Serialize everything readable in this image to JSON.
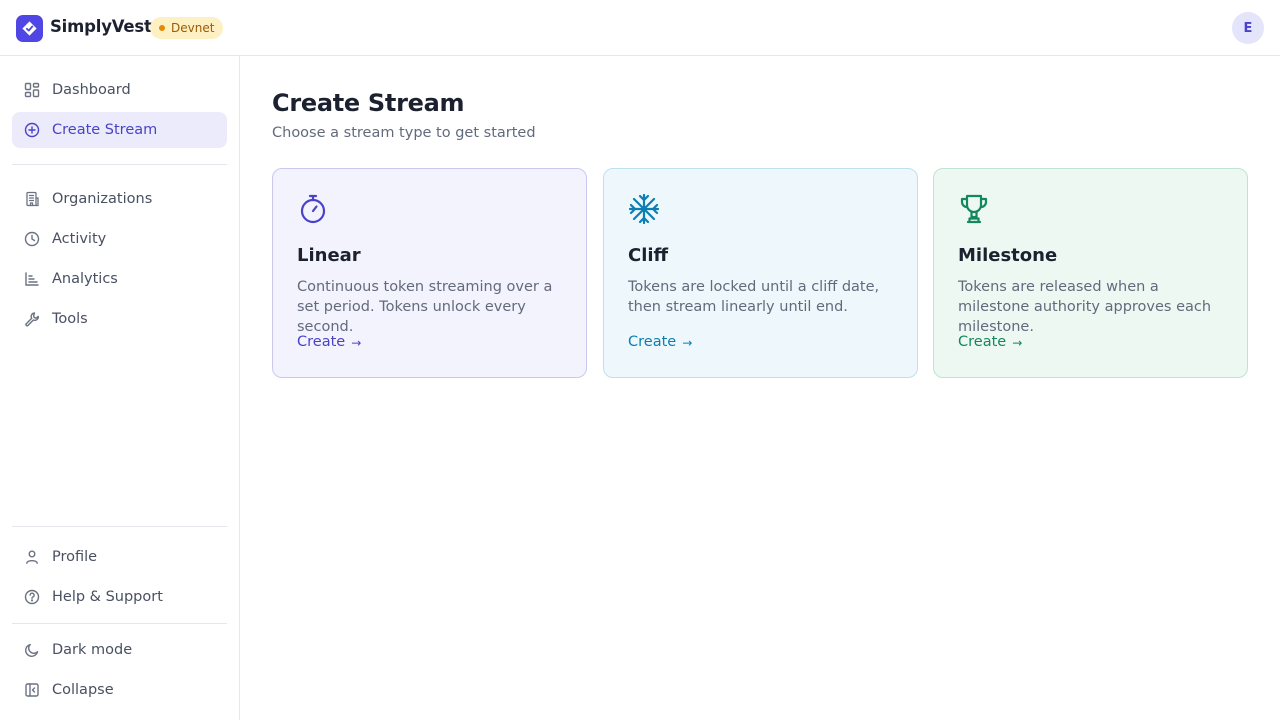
{
  "header": {
    "brand": "SimplyVest",
    "env_badge": "Devnet",
    "avatar_initial": "E"
  },
  "sidebar": {
    "top_items": [
      {
        "label": "Dashboard",
        "icon": "dashboard-icon"
      },
      {
        "label": "Create Stream",
        "icon": "plus-circle-icon",
        "active": true
      }
    ],
    "main_items": [
      {
        "label": "Organizations",
        "icon": "building-icon"
      },
      {
        "label": "Activity",
        "icon": "clock-icon"
      },
      {
        "label": "Analytics",
        "icon": "bar-chart-icon"
      },
      {
        "label": "Tools",
        "icon": "wrench-icon"
      }
    ],
    "bottom_items": [
      {
        "label": "Profile",
        "icon": "user-icon"
      },
      {
        "label": "Help & Support",
        "icon": "help-circle-icon"
      }
    ],
    "footer_items": [
      {
        "label": "Dark mode",
        "icon": "moon-icon"
      },
      {
        "label": "Collapse",
        "icon": "collapse-icon"
      }
    ]
  },
  "page": {
    "title": "Create Stream",
    "subtitle": "Choose a stream type to get started"
  },
  "cards": [
    {
      "title": "Linear",
      "description": "Continuous token streaming over a set period. Tokens unlock every second.",
      "link": "Create",
      "arrow": "→",
      "icon": "stopwatch-icon",
      "accent": "#4a43c9",
      "background": "#f3f3fd",
      "border": "#c9c8ef"
    },
    {
      "title": "Cliff",
      "description": "Tokens are locked until a cliff date, then stream linearly until end.",
      "link": "Create",
      "arrow": "→",
      "icon": "snowflake-icon",
      "accent": "#0b7fb3",
      "background": "#eef7fb",
      "border": "#bfe0ee"
    },
    {
      "title": "Milestone",
      "description": "Tokens are released when a milestone authority approves each milestone.",
      "link": "Create",
      "arrow": "→",
      "icon": "trophy-icon",
      "accent": "#13875d",
      "background": "#eef8f3",
      "border": "#c0e3d2"
    }
  ]
}
